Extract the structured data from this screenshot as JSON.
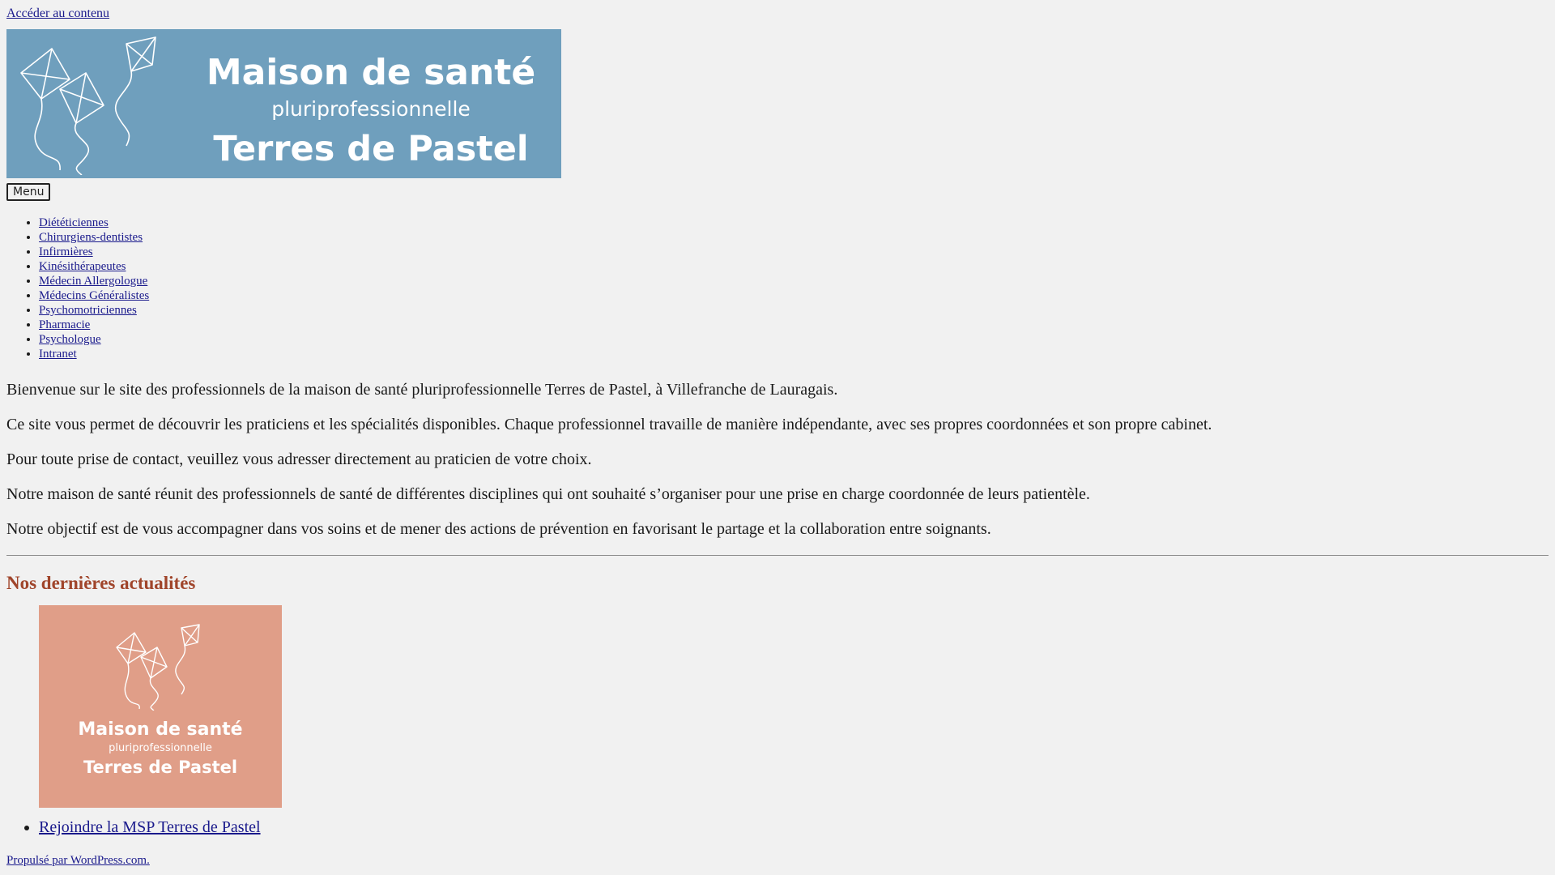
{
  "skip_link": "Accéder au contenu",
  "logo": {
    "line1": "Maison de santé",
    "line2": "pluriprofessionnelle",
    "line3": "Terres de Pastel",
    "background": "#6f9fbd"
  },
  "menu_button": "Menu",
  "nav": {
    "items": [
      "Diététiciennes",
      "Chirurgiens-dentistes",
      "Infirmières",
      "Kinésithérapeutes",
      "Médecin Allergologue",
      "Médecins Généralistes",
      "Psychomotriciennes",
      "Pharmacie",
      "Psychologue",
      "Intranet"
    ]
  },
  "content": {
    "paragraphs": [
      "Bienvenue sur le site des professionnels de la maison de santé pluriprofessionnelle Terres de Pastel, à Villefranche de Lauragais.",
      "Ce site vous permet de découvrir les praticiens et les spécialités disponibles. Chaque professionnel travaille de manière indépendante, avec ses propres coordonnées et son propre cabinet.",
      "Pour toute prise de contact, veuillez vous adresser directement au praticien de votre choix.",
      "Notre maison de santé réunit des professionnels de santé de différentes disciplines qui ont souhaité s’organiser pour une prise en charge coordonnée de leurs patientèle.",
      "Notre objectif est de vous accompagner dans vos soins et de mener des actions de prévention en favorisant le partage et la collaboration entre soignants."
    ]
  },
  "news": {
    "title": "Nos dernières actualités",
    "title_color": "#a0452b",
    "posts": [
      {
        "thumb_line1": "Maison de santé",
        "thumb_line2": "pluriprofessionnelle",
        "thumb_line3": "Terres de Pastel",
        "thumb_color": "#e09e88",
        "link": "Rejoindre la MSP Terres de Pastel"
      }
    ]
  },
  "footer": {
    "credit": "Propulsé par WordPress.com."
  }
}
